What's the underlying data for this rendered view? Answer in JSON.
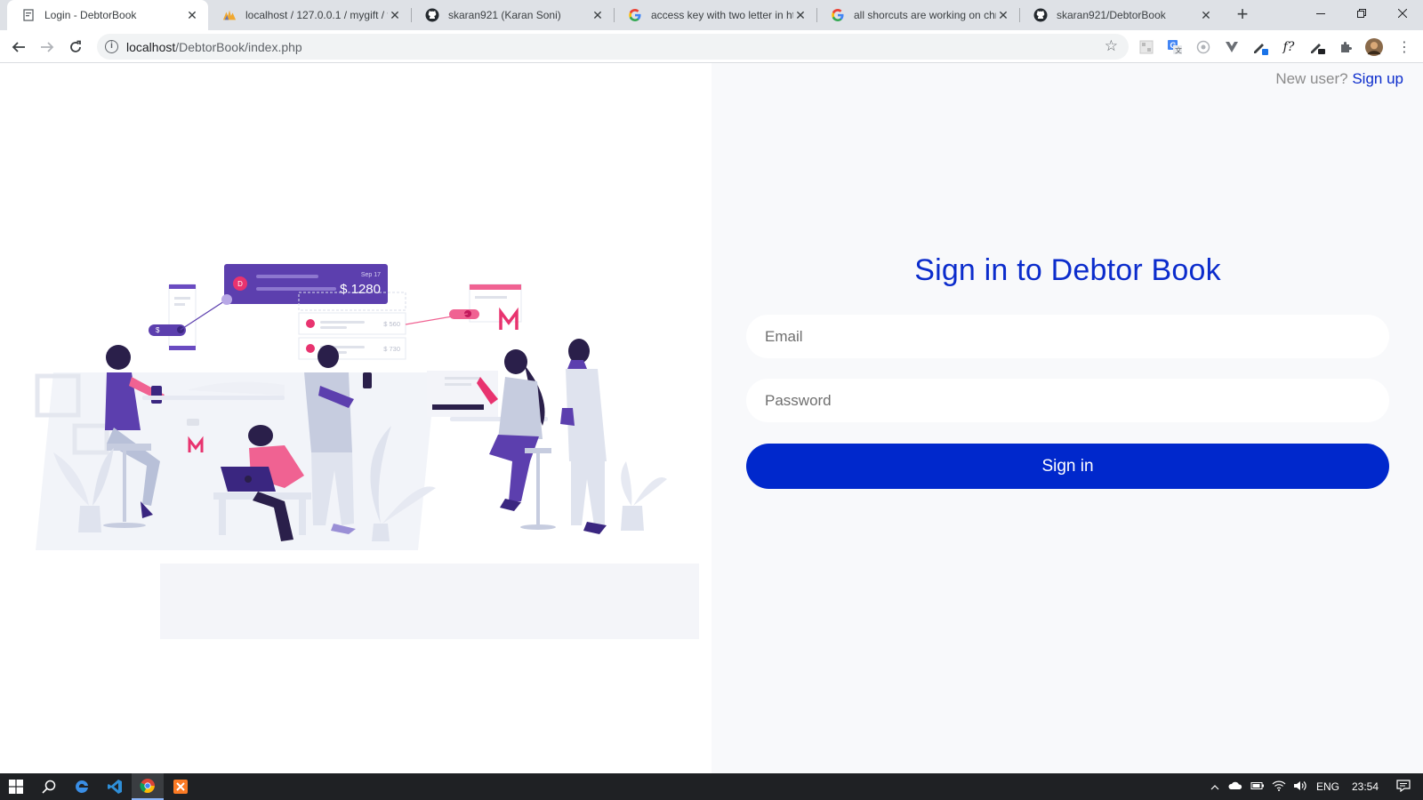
{
  "browser": {
    "tabs": [
      {
        "title": "Login - DebtorBook",
        "active": true,
        "favicon": "page-icon"
      },
      {
        "title": "localhost / 127.0.0.1 / mygift / t",
        "active": false,
        "favicon": "phpmyadmin-icon"
      },
      {
        "title": "skaran921 (Karan Soni)",
        "active": false,
        "favicon": "github-icon"
      },
      {
        "title": "access key with two letter in htm",
        "active": false,
        "favicon": "google-icon"
      },
      {
        "title": "all shorcuts are working on chr",
        "active": false,
        "favicon": "google-icon"
      },
      {
        "title": "skaran921/DebtorBook",
        "active": false,
        "favicon": "github-icon"
      }
    ],
    "address": {
      "host": "localhost",
      "path": "/DebtorBook/index.php"
    },
    "colors": {
      "tab_strip": "#dee1e6",
      "omnibox": "#f1f3f4"
    }
  },
  "page": {
    "new_user_text": "New user?",
    "signup_link": "Sign up",
    "form": {
      "title": "Sign in to Debtor Book",
      "email_placeholder": "Email",
      "password_placeholder": "Password",
      "submit_label": "Sign in"
    },
    "illustration": {
      "card_date": "Sep 17",
      "card_amount": "$ 1280",
      "card_avatar": "D",
      "row1_amount": "$ 560",
      "row2_amount": "$ 730",
      "chip_symbol": "$"
    },
    "colors": {
      "accent": "#0b2ccc",
      "button": "#0028cc",
      "panel_bg": "#f8f9fb"
    }
  },
  "taskbar": {
    "language": "ENG",
    "time": "23:54"
  }
}
